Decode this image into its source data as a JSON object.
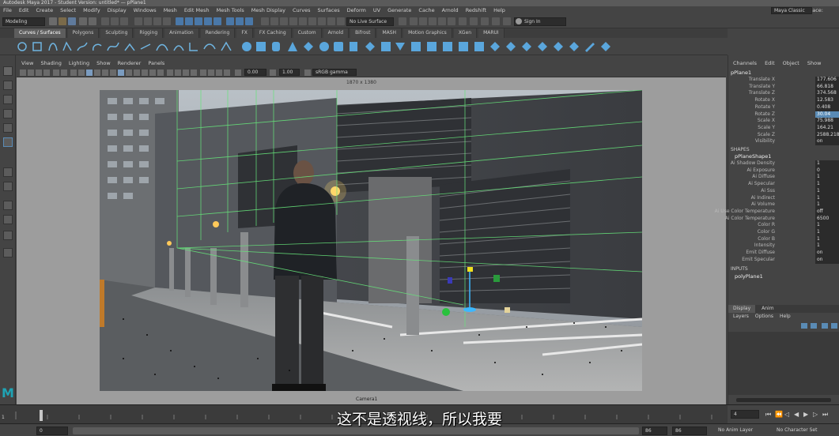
{
  "window_title": "Autodesk Maya 2017 - Student Version: untitled* — pPlane1",
  "menus": [
    "File",
    "Edit",
    "Create",
    "Select",
    "Modify",
    "Display",
    "Windows",
    "Mesh",
    "Edit Mesh",
    "Mesh Tools",
    "Mesh Display",
    "Curves",
    "Surfaces",
    "Deform",
    "UV",
    "Generate",
    "Cache",
    "Arnold",
    "Redshift",
    "Help"
  ],
  "workspace_label": "Workspace:",
  "workspace_value": "Maya Classic",
  "mode_dropdown": "Modeling",
  "live_surface": "No Live Surface",
  "sign_in": "Sign In",
  "shelf_tabs": [
    "Curves / Surfaces",
    "Polygons",
    "Sculpting",
    "Rigging",
    "Animation",
    "Rendering",
    "FX",
    "FX Caching",
    "Custom",
    "Arnold",
    "Bifrost",
    "MASH",
    "Motion Graphics",
    "XGen",
    "MARUI"
  ],
  "active_shelf_tab": 0,
  "panel_menus": [
    "View",
    "Shading",
    "Lighting",
    "Show",
    "Renderer",
    "Panels"
  ],
  "panel_fields": {
    "v1": "0.00",
    "v2": "1.00",
    "colorspace": "sRGB gamma"
  },
  "resolution": "1870 x 1380",
  "camera_label": "Camera1",
  "channel_box": {
    "menus": [
      "Channels",
      "Edit",
      "Object",
      "Show"
    ],
    "object_name": "pPlane1",
    "attributes": [
      {
        "label": "Translate X",
        "value": "177.606",
        "hl": false
      },
      {
        "label": "Translate Y",
        "value": "66.818",
        "hl": false
      },
      {
        "label": "Translate Z",
        "value": "374.568",
        "hl": false
      },
      {
        "label": "Rotate X",
        "value": "12.583",
        "hl": false
      },
      {
        "label": "Rotate Y",
        "value": "0.408",
        "hl": false
      },
      {
        "label": "Rotate Z",
        "value": "30.04",
        "hl": true
      },
      {
        "label": "Scale X",
        "value": "75.988",
        "hl": false
      },
      {
        "label": "Scale Y",
        "value": "164.21",
        "hl": false
      },
      {
        "label": "Scale Z",
        "value": "2588.218",
        "hl": false
      },
      {
        "label": "Visibility",
        "value": "on",
        "hl": false
      }
    ],
    "shapes_header": "SHAPES",
    "shape_name": "pPlaneShape1",
    "shape_attributes": [
      {
        "label": "Ai Shadow Density",
        "value": "1"
      },
      {
        "label": "Ai Exposure",
        "value": "0"
      },
      {
        "label": "Ai Diffuse",
        "value": "1"
      },
      {
        "label": "Ai Specular",
        "value": "1"
      },
      {
        "label": "Ai Sss",
        "value": "1"
      },
      {
        "label": "Ai Indirect",
        "value": "1"
      },
      {
        "label": "Ai Volume",
        "value": "1"
      },
      {
        "label": "Ai Use Color Temperature",
        "value": "off"
      },
      {
        "label": "Ai Color Temperature",
        "value": "6500"
      },
      {
        "label": "Color R",
        "value": "1"
      },
      {
        "label": "Color G",
        "value": "1"
      },
      {
        "label": "Color B",
        "value": "1"
      },
      {
        "label": "Intensity",
        "value": "1"
      },
      {
        "label": "Emit Diffuse",
        "value": "on"
      },
      {
        "label": "Emit Specular",
        "value": "on"
      }
    ],
    "inputs_header": "INPUTS",
    "input_name": "polyPlane1"
  },
  "layer_editor": {
    "tabs": [
      "Display",
      "Anim"
    ],
    "menus": [
      "Layers",
      "Options",
      "Help"
    ]
  },
  "timeline": {
    "current_frame": "4",
    "start": "1"
  },
  "range_bar": {
    "start": "0",
    "start2": "0",
    "end": "86",
    "end2": "86",
    "anim_layer": "No Anim Layer",
    "char_set": "No Character Set"
  },
  "subtitle": "这不是透视线，所以我要",
  "colors": {
    "accent": "#5a8bb5",
    "maya_logo": "#1fa3b4"
  }
}
